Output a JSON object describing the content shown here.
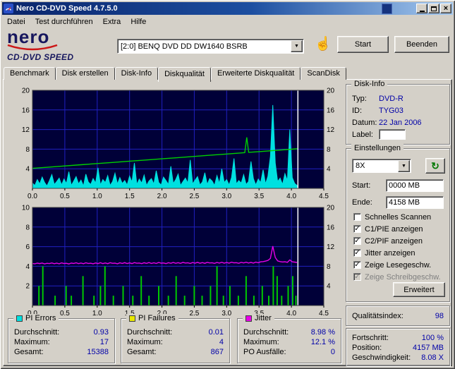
{
  "window": {
    "title": "Nero CD-DVD Speed 4.7.5.0"
  },
  "icons": {
    "dropdown": "▼",
    "refresh": "↻",
    "hand": "☝",
    "close": "×",
    "check": "✓"
  },
  "menu": {
    "items": [
      "Datei",
      "Test durchführen",
      "Extra",
      "Hilfe"
    ]
  },
  "toolbar": {
    "logo_main": "nero",
    "logo_sub": "CD·DVD SPEED",
    "drive": "[2:0]   BENQ DVD DD DW1640 BSRB",
    "start": "Start",
    "quit": "Beenden"
  },
  "tabs": {
    "items": [
      {
        "label": "Benchmark",
        "active": false
      },
      {
        "label": "Disk erstellen",
        "active": false
      },
      {
        "label": "Disk-Info",
        "active": false
      },
      {
        "label": "Diskqualität",
        "active": true
      },
      {
        "label": "Erweiterte Diskqualität",
        "active": false
      },
      {
        "label": "ScanDisk",
        "active": false
      }
    ]
  },
  "disk_info": {
    "title": "Disk-Info",
    "typ_label": "Typ:",
    "typ": "DVD-R",
    "id_label": "ID:",
    "id": "TYG03",
    "datum_label": "Datum:",
    "datum": "22 Jan 2006",
    "label_label": "Label:",
    "label_value": ""
  },
  "settings": {
    "title": "Einstellungen",
    "speed": "8X",
    "start_label": "Start:",
    "start_value": "0000 MB",
    "end_label": "Ende:",
    "end_value": "4158 MB",
    "checkboxes": [
      {
        "label": "Schnelles Scannen",
        "checked": false,
        "disabled": false
      },
      {
        "label": "C1/PIE anzeigen",
        "checked": true,
        "disabled": false
      },
      {
        "label": "C2/PIF anzeigen",
        "checked": true,
        "disabled": false
      },
      {
        "label": "Jitter anzeigen",
        "checked": true,
        "disabled": false
      },
      {
        "label": "Zeige Lesegeschw.",
        "checked": true,
        "disabled": false
      },
      {
        "label": "Zeige Schreibgeschw.",
        "checked": true,
        "disabled": true
      }
    ],
    "advanced": "Erweitert"
  },
  "quality_index": {
    "label": "Qualitätsindex:",
    "value": "98"
  },
  "progress": {
    "fortschritt_label": "Fortschritt:",
    "fortschritt": "100 %",
    "position_label": "Position:",
    "position": "4157 MB",
    "geschw_label": "Geschwindigkeit:",
    "geschw": "8.08 X"
  },
  "stats": {
    "pie": {
      "title": "PI Errors",
      "color": "#00e0e0",
      "avg_label": "Durchschnitt:",
      "avg": "0.93",
      "max_label": "Maximum:",
      "max": "17",
      "total_label": "Gesamt:",
      "total": "15388"
    },
    "pif": {
      "title": "PI Failures",
      "color": "#e8e800",
      "avg_label": "Durchschnitt:",
      "avg": "0.01",
      "max_label": "Maximum:",
      "max": "4",
      "total_label": "Gesamt:",
      "total": "867"
    },
    "jitter": {
      "title": "Jitter",
      "color": "#e800e8",
      "avg_label": "Durchschnitt:",
      "avg": "8.98 %",
      "max_label": "Maximum:",
      "max": "12.1 %",
      "total_label": "PO Ausfälle:",
      "total": "0"
    }
  },
  "chart_data": [
    {
      "type": "area",
      "name": "PI Errors und Lesegeschwindigkeit",
      "x_range": [
        0,
        4.5
      ],
      "x_ticks": [
        0,
        0.5,
        1,
        1.5,
        2,
        2.5,
        3,
        3.5,
        4,
        4.5
      ],
      "x_tick_labels": [
        "0.0",
        "0.5",
        "1.0",
        "1.5",
        "2.0",
        "2.5",
        "3.0",
        "3.5",
        "4.0",
        "4.5"
      ],
      "y_left": {
        "max": 20,
        "ticks": [
          4,
          8,
          12,
          16,
          20
        ]
      },
      "y_right": {
        "max": 20,
        "ticks": [
          4,
          8,
          12,
          16,
          20
        ]
      },
      "marker_x": 4.1,
      "bg": "#000038",
      "grid_color": "#2020c0",
      "series": [
        {
          "name": "PI Errors",
          "axis": "left",
          "style": "area",
          "color": "#00e0e0",
          "x_start": 0,
          "x_step": 0.0375,
          "values": [
            1.1,
            0.6,
            1.8,
            0.9,
            2.3,
            1.2,
            0.5,
            1.6,
            2.8,
            0.8,
            1.4,
            2.1,
            0.7,
            1.9,
            1.0,
            3.4,
            0.6,
            1.5,
            2.4,
            0.9,
            1.7,
            0.5,
            2.9,
            1.3,
            0.8,
            2.0,
            1.1,
            4.2,
            0.7,
            1.8,
            1.2,
            2.6,
            0.6,
            1.4,
            3.1,
            0.9,
            2.2,
            1.0,
            1.6,
            0.7,
            2.5,
            1.3,
            5.2,
            0.8,
            1.9,
            1.1,
            2.7,
            0.6,
            1.5,
            2.0,
            0.9,
            3.6,
            1.2,
            0.7,
            2.3,
            1.6,
            0.8,
            4.5,
            1.0,
            1.8,
            2.9,
            0.6,
            1.4,
            2.1,
            1.1,
            5.8,
            0.9,
            1.7,
            2.4,
            0.7,
            1.3,
            3.2,
            0.8,
            2.0,
            1.5,
            0.6,
            2.6,
            1.0,
            4.0,
            1.2,
            1.8,
            0.7,
            2.2,
            6.1,
            0.9,
            1.6,
            1.1,
            2.8,
            0.8,
            1.4,
            5.5,
            2.0,
            0.7,
            1.9,
            1.2,
            3.8,
            0.9,
            2.5,
            6.5,
            17,
            5.2,
            1.4,
            2.1,
            0.8,
            3.0,
            1.6,
            12.0,
            2.2,
            1.0,
            0.6
          ]
        },
        {
          "name": "Lesegeschwindigkeit",
          "axis": "right",
          "style": "line",
          "color": "#00d000",
          "points": [
            [
              0,
              4.08
            ],
            [
              0.25,
              4.33
            ],
            [
              0.5,
              4.57
            ],
            [
              0.75,
              4.82
            ],
            [
              1.0,
              5.06
            ],
            [
              1.25,
              5.3
            ],
            [
              1.5,
              5.55
            ],
            [
              1.75,
              5.79
            ],
            [
              2.0,
              6.03
            ],
            [
              2.25,
              6.28
            ],
            [
              2.5,
              6.52
            ],
            [
              2.75,
              6.77
            ],
            [
              3.0,
              7.01
            ],
            [
              3.2,
              7.21
            ],
            [
              3.28,
              7.29
            ],
            [
              3.31,
              10.4
            ],
            [
              3.34,
              7.35
            ],
            [
              3.5,
              7.5
            ],
            [
              3.75,
              7.74
            ],
            [
              4.0,
              7.99
            ],
            [
              4.09,
              8.08
            ]
          ]
        }
      ]
    },
    {
      "type": "line",
      "name": "PI Failures und Jitter",
      "x_range": [
        0,
        4.5
      ],
      "x_ticks": [
        0,
        0.5,
        1,
        1.5,
        2,
        2.5,
        3,
        3.5,
        4,
        4.5
      ],
      "x_tick_labels": [
        "0.0",
        "0.5",
        "1.0",
        "1.5",
        "2.0",
        "2.5",
        "3.0",
        "3.5",
        "4.0",
        "4.5"
      ],
      "y_left": {
        "max": 10,
        "ticks": [
          2,
          4,
          6,
          8,
          10
        ]
      },
      "y_right": {
        "max": 20,
        "ticks": [
          4,
          8,
          12,
          16,
          20
        ]
      },
      "marker_x": 4.1,
      "bg": "#000038",
      "grid_color": "#2020c0",
      "series": [
        {
          "name": "PI Failures",
          "axis": "left",
          "style": "spikes",
          "color": "#00c800",
          "points": [
            [
              0.1,
              2
            ],
            [
              0.16,
              4
            ],
            [
              0.35,
              1
            ],
            [
              0.52,
              2
            ],
            [
              0.6,
              1
            ],
            [
              0.78,
              3
            ],
            [
              0.95,
              1
            ],
            [
              1.05,
              2
            ],
            [
              1.12,
              4
            ],
            [
              1.25,
              1
            ],
            [
              1.4,
              2
            ],
            [
              1.55,
              1
            ],
            [
              1.68,
              3
            ],
            [
              1.8,
              1
            ],
            [
              1.95,
              2
            ],
            [
              2.1,
              1
            ],
            [
              2.22,
              3
            ],
            [
              2.35,
              1
            ],
            [
              2.5,
              2
            ],
            [
              2.62,
              1
            ],
            [
              2.75,
              2
            ],
            [
              2.85,
              4
            ],
            [
              2.95,
              1
            ],
            [
              3.05,
              2
            ],
            [
              3.18,
              1
            ],
            [
              3.3,
              3
            ],
            [
              3.42,
              1
            ],
            [
              3.55,
              2
            ],
            [
              3.65,
              1
            ],
            [
              3.72,
              4
            ],
            [
              3.78,
              3
            ],
            [
              3.85,
              1
            ],
            [
              3.95,
              2
            ],
            [
              4.02,
              3
            ],
            [
              4.07,
              1
            ]
          ]
        },
        {
          "name": "Jitter",
          "axis": "right",
          "style": "line",
          "color": "#e800e8",
          "x_start": 0,
          "x_step": 0.0375,
          "values": [
            8.58,
            8.5,
            8.63,
            8.54,
            8.66,
            8.49,
            8.61,
            8.55,
            8.67,
            8.52,
            8.64,
            8.51,
            8.69,
            8.56,
            8.6,
            8.48,
            8.65,
            8.57,
            8.7,
            8.53,
            8.66,
            8.52,
            8.71,
            8.58,
            8.62,
            8.5,
            8.68,
            8.55,
            8.72,
            8.54,
            8.67,
            8.53,
            8.73,
            8.6,
            8.64,
            8.51,
            8.7,
            8.57,
            8.74,
            8.56,
            8.69,
            8.55,
            8.75,
            8.62,
            8.66,
            8.53,
            8.72,
            8.59,
            8.76,
            8.58,
            8.71,
            8.57,
            8.77,
            8.64,
            8.68,
            8.55,
            8.74,
            8.61,
            8.78,
            8.6,
            8.73,
            8.59,
            8.79,
            8.66,
            8.7,
            8.57,
            8.76,
            8.63,
            8.8,
            8.62,
            8.75,
            8.61,
            8.81,
            8.68,
            8.72,
            8.59,
            8.78,
            8.65,
            8.82,
            8.64,
            8.77,
            8.63,
            8.83,
            8.7,
            8.74,
            8.61,
            8.8,
            8.67,
            8.84,
            8.66,
            8.79,
            8.65,
            8.85,
            8.72,
            8.9,
            8.95,
            9.05,
            9.2,
            9.6,
            12.1,
            9.8,
            9.1,
            8.95,
            8.88,
            8.92,
            8.8,
            9.3,
            8.9,
            8.85,
            8.78
          ]
        }
      ]
    }
  ]
}
